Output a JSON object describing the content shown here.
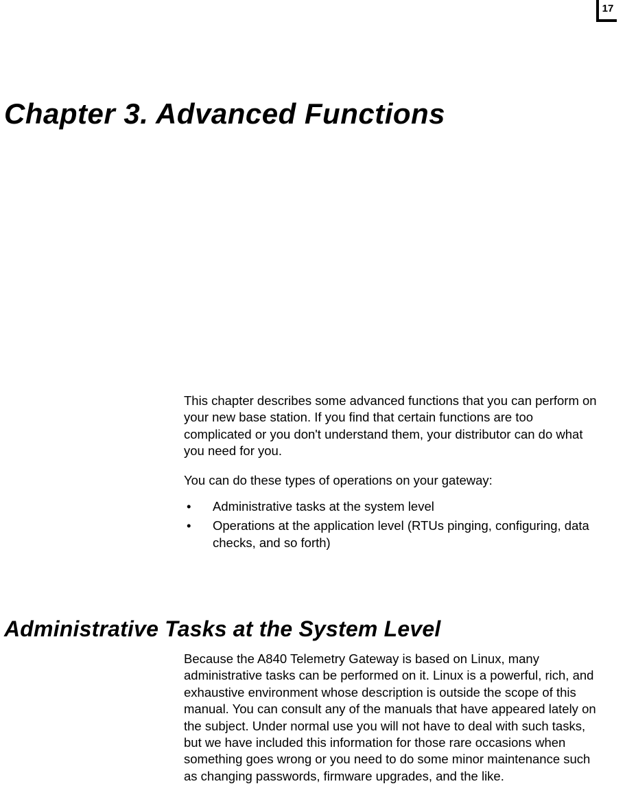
{
  "page_number": "17",
  "chapter_title": "Chapter 3. Advanced Functions",
  "intro_para": "This chapter describes some advanced functions that you can perform on your new base station. If you find that certain functions are too complicated or you don't understand them, your distributor can do what you need for you.",
  "ops_intro": "You can do these types of operations on your gateway:",
  "bullets": {
    "b0": "Administrative tasks at the system level",
    "b1": "Operations at the application level (RTUs pinging, configuring, data checks, and so forth)"
  },
  "section_heading": "Administrative Tasks at the System Level",
  "section_body": "Because the A840 Telemetry Gateway is based on Linux, many administrative tasks can be performed on it. Linux is a powerful, rich, and exhaustive environment whose description is outside the scope of this manual. You can consult any of the manuals that have appeared lately on the subject. Under normal use you will not have to deal with such tasks, but we have included this information for those rare occasions when something goes wrong or you need to do some minor maintenance such as changing passwords, firmware upgrades, and the like."
}
